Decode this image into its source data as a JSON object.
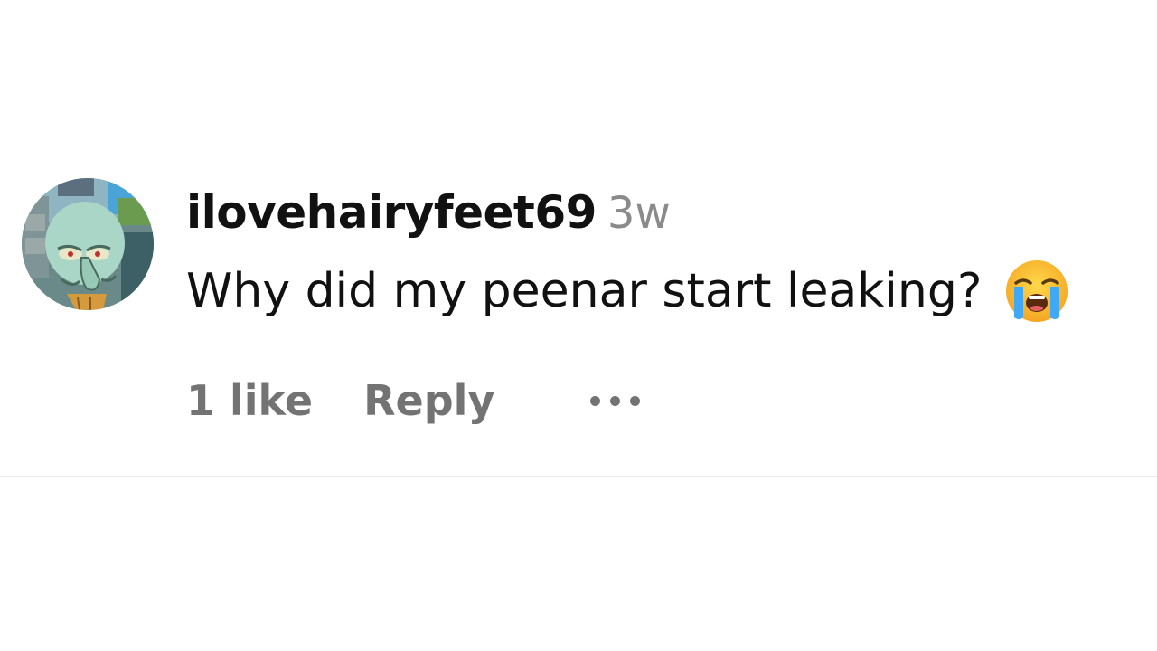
{
  "comment": {
    "username": "ilovehairyfeet69",
    "timestamp": "3w",
    "text": "Why did my peenar start leaking?",
    "emoji": "loudly-crying-face-emoji",
    "likes_label": "1 like",
    "reply_label": "Reply",
    "more_icon": "more-options-icon"
  },
  "colors": {
    "primary_text": "#111111",
    "secondary_text": "#737373",
    "timestamp": "#8a8a8a",
    "divider": "#eaeaea",
    "background": "#ffffff"
  }
}
